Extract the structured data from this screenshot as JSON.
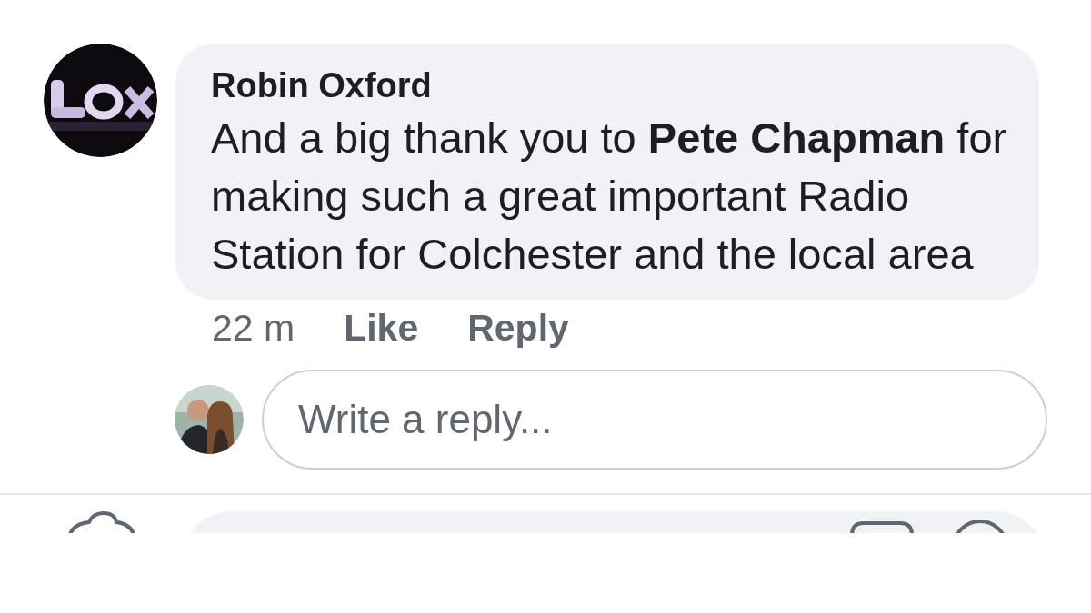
{
  "comment": {
    "author": "Robin Oxford",
    "text": "And a big thank you to **Pete Chapman** for making such a great important Radio Station for Colchester and the local area"
  },
  "meta": {
    "time": "22 m",
    "actions": [
      {
        "label": "Like"
      },
      {
        "label": "Reply"
      }
    ]
  },
  "reply_box": {
    "placeholder": "Write a reply..."
  }
}
